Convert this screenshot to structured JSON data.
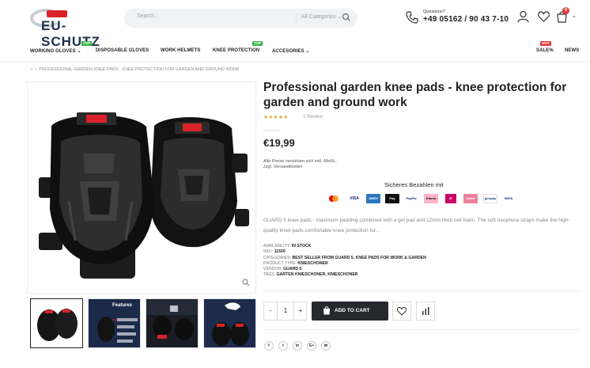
{
  "header": {
    "logo_text": "EU-SCHUTZ",
    "search_placeholder": "Search...",
    "search_category": "All Categories",
    "questions_label": "Questions?",
    "phone": "+49 05162 / 90 43 7-10",
    "cart_count": "0"
  },
  "nav": {
    "items": [
      {
        "label": "WORKING GLOVES"
      },
      {
        "label": "DISPOSABLE GLOVES"
      },
      {
        "label": "WORK HELMETS"
      },
      {
        "label": "KNEE PROTECTION"
      },
      {
        "label": "ACCESORIES"
      },
      {
        "label": "SALE%"
      },
      {
        "label": "NEWS"
      }
    ],
    "badge_top": "TOP",
    "badge_hot": "HOT"
  },
  "breadcrumb": {
    "path": "PROFESSIONAL GARDEN KNEE PADS - KNEE PROTECTION FOR GARDEN AND GROUND WORK"
  },
  "product": {
    "title": "Professional garden knee pads - knee protection for garden and ground work",
    "stars": "★★★★★",
    "rating": 5,
    "reviews": "1 Review",
    "price": "€19,99",
    "vat_note_line1": "Alle Preise verstehen sich inkl. MwSt.,",
    "vat_note_line2": "zzgl. Versandkosten",
    "payment_title": "Sicheres Bezahlen mit",
    "payment_methods": [
      "mastercard",
      "VISA",
      "AMEX",
      "Pay",
      "PayPal",
      "Klarna",
      "iD",
      "sofort",
      "giropay",
      "SEPA"
    ],
    "description": "GUARD 5 knee pads - maximum padding combined with a gel pad and 12mm thick cell foam. The soft neoprene straps make the high-quality knee pads comfortable knee protection for...",
    "meta": {
      "availability_label": "AVAILABILITY:",
      "availability": "IN STOCK",
      "sku_label": "SKU:",
      "sku": "11500",
      "categories_label": "CATEGORIES:",
      "categories": "BEST SELLER FROM GUARD 5, KNEE PADS FOR WORK & GARDEN",
      "type_label": "PRODUCT TYPE:",
      "type": "KNIESCHONER",
      "vendor_label": "VENDOR:",
      "vendor": "GUARD 5",
      "tags_label": "TAGS:",
      "tags": "GARTEN KNIESCHONER, KNIESCHONER"
    },
    "quantity": "1",
    "minus": "-",
    "plus": "+",
    "add_to_cart": "ADD TO CART",
    "thumb_features": "Features"
  },
  "social": [
    "f",
    "t",
    "in",
    "G+",
    "✉"
  ],
  "colors": {
    "accent": "#25282d",
    "badge_top": "#3ab54a",
    "badge_hot": "#e03a3a",
    "stars": "#e4a02a"
  }
}
